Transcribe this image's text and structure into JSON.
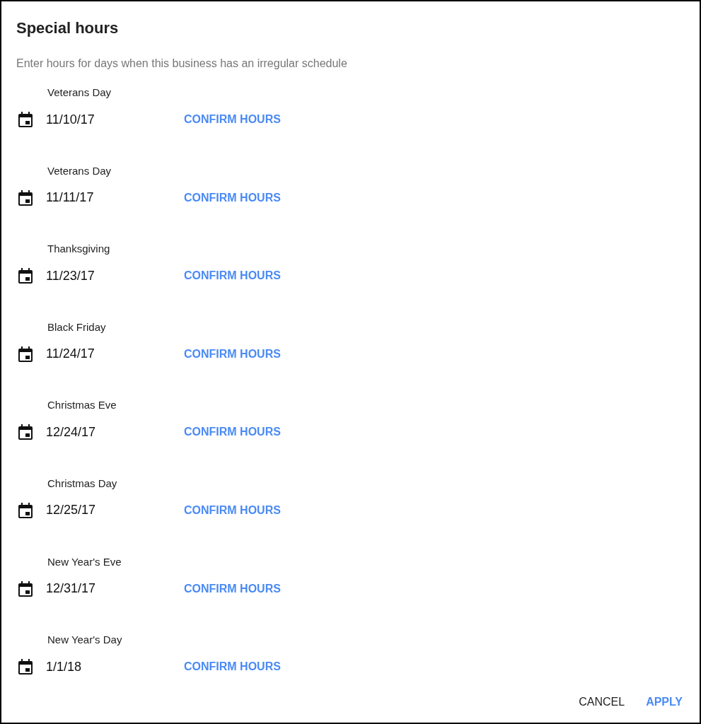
{
  "dialog": {
    "title": "Special hours",
    "subtitle": "Enter hours for days when this business has an irregular schedule",
    "days": [
      {
        "name": "Veterans Day",
        "date": "11/10/17",
        "action": "CONFIRM HOURS"
      },
      {
        "name": "Veterans Day",
        "date": "11/11/17",
        "action": "CONFIRM HOURS"
      },
      {
        "name": "Thanksgiving",
        "date": "11/23/17",
        "action": "CONFIRM HOURS"
      },
      {
        "name": "Black Friday",
        "date": "11/24/17",
        "action": "CONFIRM HOURS"
      },
      {
        "name": "Christmas Eve",
        "date": "12/24/17",
        "action": "CONFIRM HOURS"
      },
      {
        "name": "Christmas Day",
        "date": "12/25/17",
        "action": "CONFIRM HOURS"
      },
      {
        "name": "New Year's Eve",
        "date": "12/31/17",
        "action": "CONFIRM HOURS"
      },
      {
        "name": "New Year's Day",
        "date": "1/1/18",
        "action": "CONFIRM HOURS"
      }
    ],
    "buttons": [
      {
        "label": "CANCEL",
        "kind": "secondary"
      },
      {
        "label": "APPLY",
        "kind": "primary"
      }
    ]
  }
}
